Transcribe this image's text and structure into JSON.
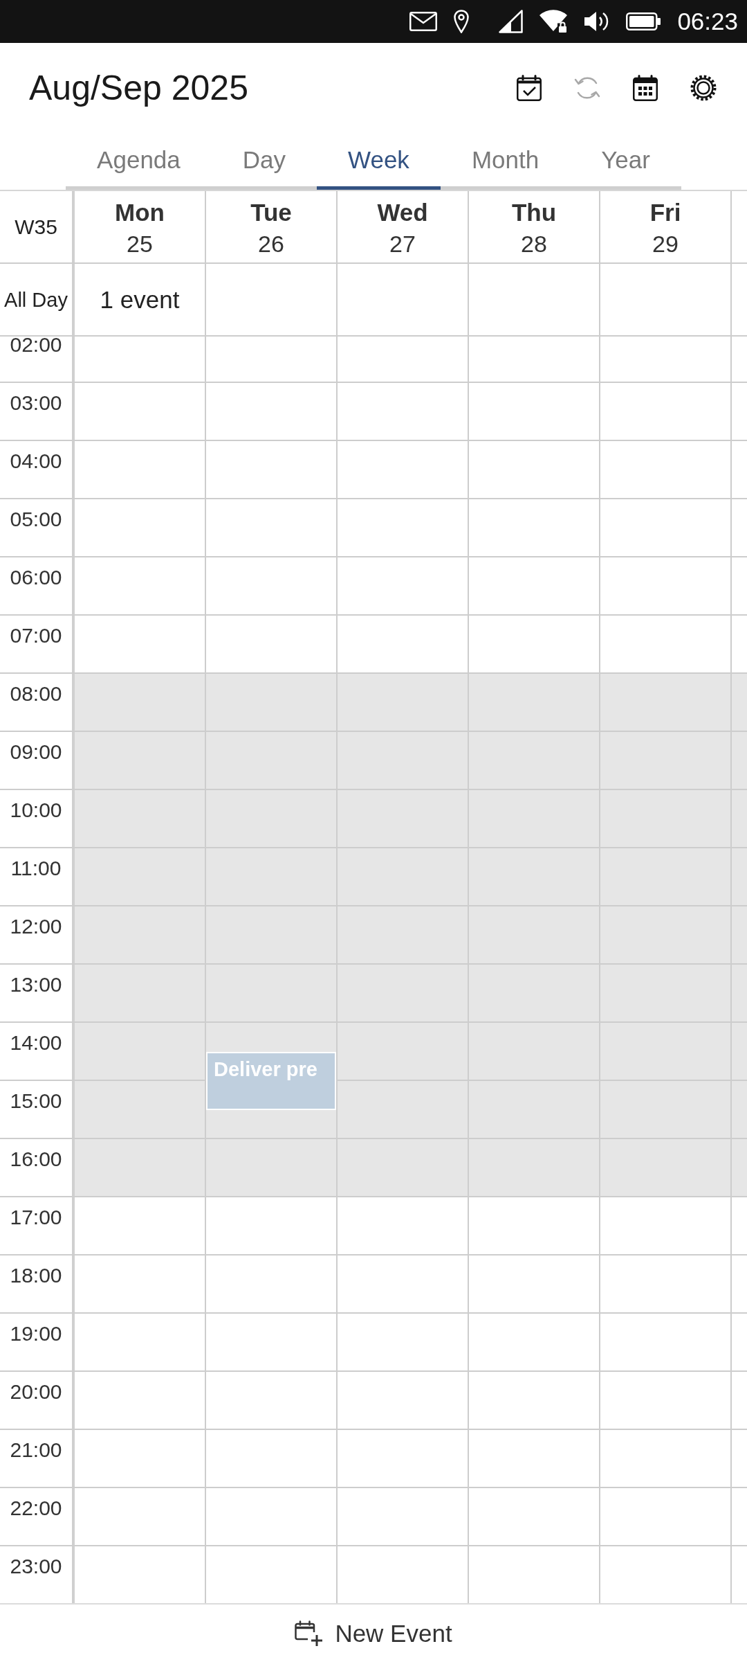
{
  "status_bar": {
    "time": "06:23"
  },
  "header": {
    "title": "Aug/Sep 2025",
    "actions": [
      {
        "kind": "today",
        "disabled": false
      },
      {
        "kind": "sync",
        "disabled": true
      },
      {
        "kind": "calendars",
        "disabled": false
      },
      {
        "kind": "settings",
        "disabled": false
      }
    ]
  },
  "tabs": [
    {
      "label": "Agenda",
      "selected": false
    },
    {
      "label": "Day",
      "selected": false
    },
    {
      "label": "Week",
      "selected": true
    },
    {
      "label": "Month",
      "selected": false
    },
    {
      "label": "Year",
      "selected": false
    }
  ],
  "week": {
    "number": "W35",
    "all_day_label": "All Day",
    "days": [
      {
        "name": "Mon",
        "date": "25",
        "all_day": "1 event"
      },
      {
        "name": "Tue",
        "date": "26"
      },
      {
        "name": "Wed",
        "date": "27"
      },
      {
        "name": "Thu",
        "date": "28"
      },
      {
        "name": "Fri",
        "date": "29"
      }
    ],
    "hours": [
      {
        "label": "02:00",
        "shaded": false
      },
      {
        "label": "03:00",
        "shaded": false
      },
      {
        "label": "04:00",
        "shaded": false
      },
      {
        "label": "05:00",
        "shaded": false
      },
      {
        "label": "06:00",
        "shaded": false
      },
      {
        "label": "07:00",
        "shaded": false
      },
      {
        "label": "08:00",
        "shaded": true
      },
      {
        "label": "09:00",
        "shaded": true
      },
      {
        "label": "10:00",
        "shaded": true
      },
      {
        "label": "11:00",
        "shaded": true
      },
      {
        "label": "12:00",
        "shaded": true
      },
      {
        "label": "13:00",
        "shaded": true
      },
      {
        "label": "14:00",
        "shaded": true,
        "cells": [
          {},
          {
            "events": [
              {
                "title": "Deliver pre",
                "half_past": true
              }
            ]
          }
        ]
      },
      {
        "label": "15:00",
        "shaded": true
      },
      {
        "label": "16:00",
        "shaded": true
      },
      {
        "label": "17:00",
        "shaded": false
      },
      {
        "label": "18:00",
        "shaded": false
      },
      {
        "label": "19:00",
        "shaded": false
      },
      {
        "label": "20:00",
        "shaded": false
      },
      {
        "label": "21:00",
        "shaded": false
      },
      {
        "label": "22:00",
        "shaded": false
      },
      {
        "label": "23:00",
        "shaded": false
      }
    ]
  },
  "new_event": {
    "label": "New Event"
  }
}
